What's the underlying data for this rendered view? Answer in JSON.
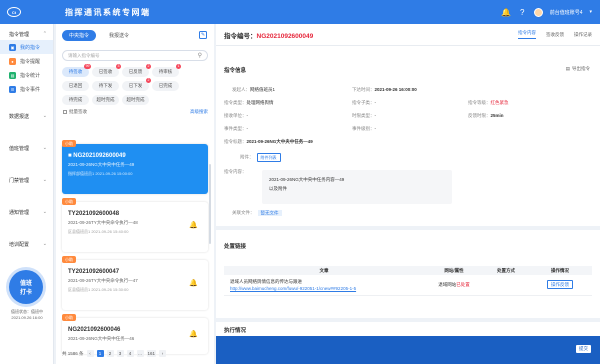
{
  "header": {
    "logo_text": "Ct",
    "title": "指挥通讯系统专网端",
    "user_name": "前台值班账号4",
    "bell_badge": "",
    "colors": {
      "primary": "#2f7ce6",
      "danger": "#e6283c",
      "tag": "#ff8a3d"
    }
  },
  "nav": {
    "groups": [
      {
        "label": "指令管理",
        "expanded": true
      },
      {
        "label": "数据报送",
        "expanded": false
      },
      {
        "label": "值班管理",
        "expanded": false
      },
      {
        "label": "门禁管理",
        "expanded": false
      },
      {
        "label": "通知管理",
        "expanded": false
      },
      {
        "label": "培训配置",
        "expanded": false
      }
    ],
    "sub_items": [
      {
        "label": "我的指令",
        "icon": "doc-icon",
        "color": "#2f7ce6",
        "active": true
      },
      {
        "label": "指令提醒",
        "icon": "bell-icon",
        "color": "#ff8a3d",
        "active": false
      },
      {
        "label": "指令统计",
        "icon": "chart-icon",
        "color": "#21b26f",
        "active": false
      },
      {
        "label": "指令事件",
        "icon": "list-icon",
        "color": "#2f7ce6",
        "active": false
      }
    ],
    "punch": {
      "line1": "值班",
      "line2": "打卡"
    },
    "shift": {
      "line1": "值班状态：值班中",
      "line2": "2021.09.26 16:00"
    }
  },
  "list": {
    "tabs": [
      "中央指令",
      "我报送令"
    ],
    "search_placeholder": "请输入指令编号",
    "filters": [
      {
        "label": "待签收",
        "badge": "99",
        "selected": true
      },
      {
        "label": "已签收",
        "badge": "3",
        "selected": false
      },
      {
        "label": "已反馈",
        "badge": "2",
        "selected": false
      },
      {
        "label": "待审核",
        "badge": "1",
        "selected": false
      },
      {
        "label": "已退回",
        "badge": "",
        "selected": false
      },
      {
        "label": "待下发",
        "badge": "",
        "selected": false
      },
      {
        "label": "已下发",
        "badge": "2",
        "selected": false
      },
      {
        "label": "已完成",
        "badge": "",
        "selected": false
      },
      {
        "label": "待完成",
        "badge": "",
        "selected": false
      },
      {
        "label": "超时完成",
        "badge": "",
        "selected": false
      },
      {
        "label": "超时完成",
        "badge": "",
        "selected": false
      }
    ],
    "select_all_label": "批量签收",
    "advanced_label": "高级搜索",
    "cards": [
      {
        "tag": "小助",
        "no": "NG2021092600049",
        "text": "2021-09-26NG大中央中任务—49",
        "meta": "指挥部值班员1    2021-09-26 15:00:00",
        "active": true
      },
      {
        "tag": "小助",
        "no": "TY2021092600048",
        "text": "2021-09-26TY大中央命令执行—48",
        "meta": "区县值班员1    2021-09-26 15:40:00",
        "active": false
      },
      {
        "tag": "小助",
        "no": "TY2021092600047",
        "text": "2021-09-26TY大中央命令执行—47",
        "meta": "区县值班员1    2021-09-26 15:30:00",
        "active": false
      },
      {
        "tag": "小助",
        "no": "NG2021092600046",
        "text": "2021-09-26NG大中央中任务—46",
        "meta": "",
        "active": false
      }
    ],
    "pager": {
      "total": "共 1586 条",
      "pages": [
        "1",
        "2",
        "3",
        "4",
        "…",
        "161"
      ],
      "current": "1"
    }
  },
  "detail": {
    "title_prefix": "指令编号：",
    "order_no": "NG2021092600049",
    "tabs": [
      "指令内容",
      "签收反馈",
      "操作记录"
    ],
    "section_info": "指令信息",
    "export_label": "导出指令",
    "fields": {
      "sender_label": "发起人：",
      "sender": "网络值班员1",
      "issue_time_label": "下达时间：",
      "issue_time": "2021-09-26 16:00:00",
      "order_type_label": "指令类型：",
      "order_type": "处理网络舆情",
      "sub_type_label": "指令子类：",
      "sub_type": "-",
      "level_label": "指令等级：",
      "level": "红色紧急",
      "receive_unit_label": "接收单位：",
      "receive_unit": "-",
      "deadline_type_label": "时限类型：",
      "deadline_type": "-",
      "limit_label": "反馈时限：",
      "limit": "25min",
      "event_type_label": "事件类型：",
      "event_type": "-",
      "event_level_label": "事件级别：",
      "event_level": "-",
      "order_title_label": "指令标题：",
      "order_title": "2021-09-26NG大中央中任务—49",
      "attach_label": "附件：",
      "attach_btn": "附件列表",
      "content_label": "指令内容：",
      "content_line1": "2021-09-26NG大中央中任务内容—49",
      "content_line2": "以及附件",
      "related_label": "关联文件：",
      "related_file": "暂无文件"
    },
    "section_links": "处置链接",
    "table": {
      "headers": [
        "文章",
        "网站/属性",
        "处置方式",
        "操作情况"
      ],
      "rows": [
        {
          "title": "退域人员网络舆情信息的传达与跟进",
          "url": "http://www.baimucheng.com/fuwu/-922051-1/cnew##92205-1-5",
          "site": "退域网站",
          "site_status": "已处置",
          "method": "",
          "action": "操作反馈"
        }
      ]
    },
    "section_exec": "执行情况",
    "submit_label": "提交"
  }
}
